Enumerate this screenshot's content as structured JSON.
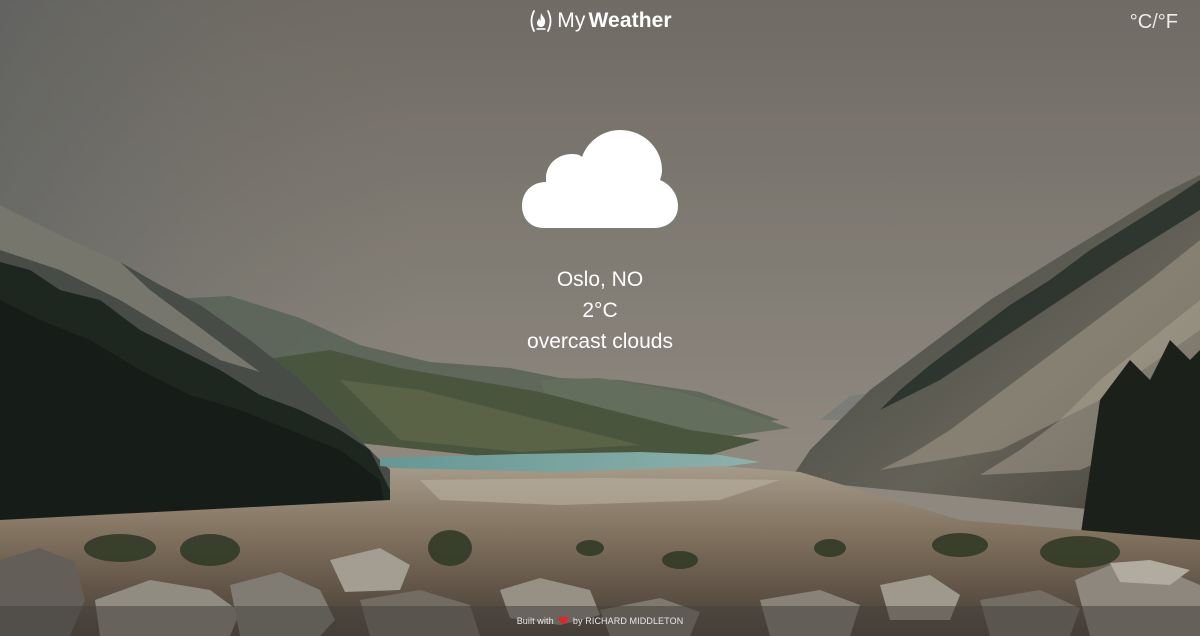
{
  "header": {
    "brand_prefix": "My",
    "brand_suffix": "Weather",
    "brand_icon": "flame-icon",
    "unit_celsius": "°C",
    "unit_separator": "/",
    "unit_fahrenheit": "°F"
  },
  "weather": {
    "icon": "cloud-icon",
    "location": "Oslo, NO",
    "temperature": "2°C",
    "description": "overcast clouds"
  },
  "footer": {
    "built_with": "Built with",
    "heart_icon": "heart-icon",
    "by": "by",
    "author": "RICHARD MIDDLETON",
    "heart_color": "#e0262a"
  }
}
